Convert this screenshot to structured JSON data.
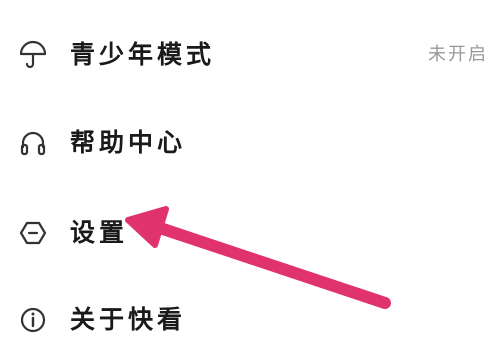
{
  "menu": {
    "items": [
      {
        "label": "青少年模式",
        "icon": "umbrella-icon",
        "status": "未开启"
      },
      {
        "label": "帮助中心",
        "icon": "headphones-icon"
      },
      {
        "label": "设置",
        "icon": "hexagon-minus-icon"
      },
      {
        "label": "关于快看",
        "icon": "info-icon"
      }
    ]
  },
  "annotation": {
    "arrow_color": "#e0336e",
    "points_to": "设置"
  },
  "colors": {
    "text": "#1a1a1a",
    "status_text": "#999999",
    "icon_stroke": "#333333",
    "background": "#ffffff"
  }
}
